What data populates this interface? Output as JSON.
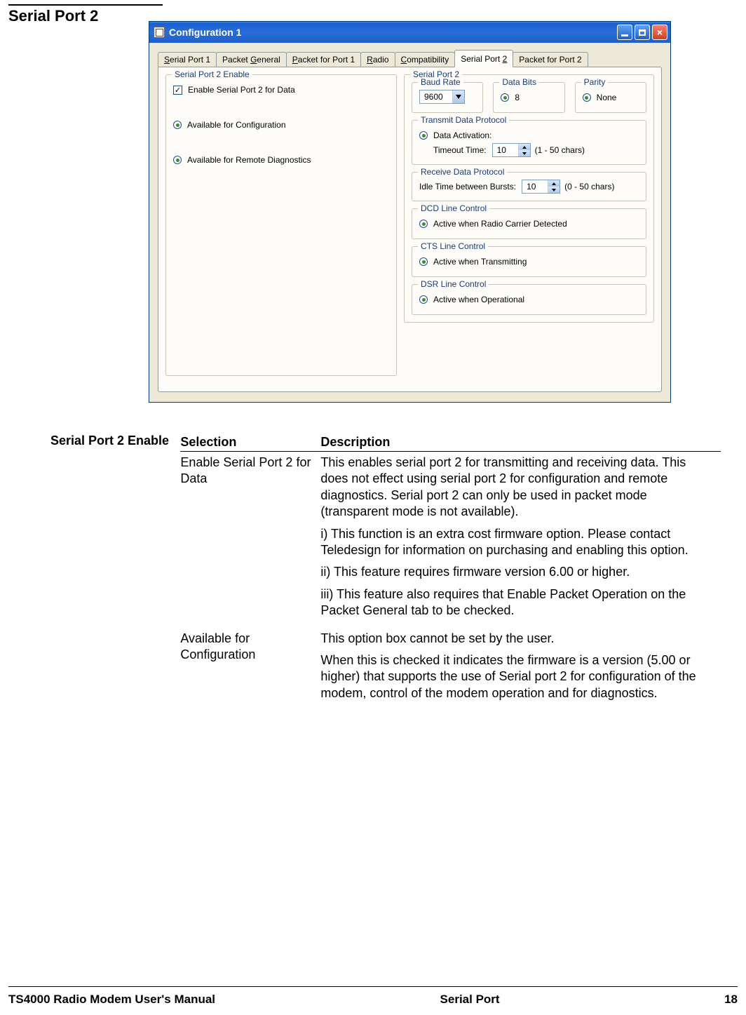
{
  "page": {
    "section_heading": "Serial Port 2",
    "footer_left": "TS4000 Radio Modem User's Manual",
    "footer_center": "Serial Port",
    "footer_right": "18"
  },
  "window": {
    "title": "Configuration 1",
    "tabs": [
      {
        "label_pre": "",
        "mnemonic": "S",
        "label_post": "erial Port 1"
      },
      {
        "label_pre": "Packet ",
        "mnemonic": "G",
        "label_post": "eneral"
      },
      {
        "label_pre": "",
        "mnemonic": "P",
        "label_post": "acket for Port 1"
      },
      {
        "label_pre": "",
        "mnemonic": "R",
        "label_post": "adio"
      },
      {
        "label_pre": "",
        "mnemonic": "C",
        "label_post": "ompatibility"
      },
      {
        "label_pre": "Serial Port ",
        "mnemonic": "2",
        "label_post": ""
      },
      {
        "label_pre": "Packet for Port 2",
        "mnemonic": "",
        "label_post": ""
      }
    ],
    "selected_tab_index": 5,
    "left": {
      "group_title": "Serial Port 2 Enable",
      "enable_label": "Enable Serial Port 2 for Data",
      "enable_checked": true,
      "avail_config_label": "Available for Configuration",
      "avail_diag_label": "Available for Remote Diagnostics"
    },
    "right": {
      "group_title": "Serial Port 2",
      "baud": {
        "title": "Baud Rate",
        "value": "9600"
      },
      "databits": {
        "title": "Data Bits",
        "label": "8"
      },
      "parity": {
        "title": "Parity",
        "label": "None"
      },
      "tx": {
        "title": "Transmit Data Protocol",
        "radio_label": "Data Activation:",
        "timeout_label": "Timeout Time:",
        "timeout_value": "10",
        "hint": "(1 - 50 chars)"
      },
      "rx": {
        "title": "Receive Data Protocol",
        "idle_label": "Idle Time between Bursts:",
        "idle_value": "10",
        "hint": "(0 - 50 chars)"
      },
      "dcd": {
        "title": "DCD Line Control",
        "label": "Active when Radio Carrier Detected"
      },
      "cts": {
        "title": "CTS Line Control",
        "label": "Active when Transmitting"
      },
      "dsr": {
        "title": "DSR Line Control",
        "label": "Active when Operational"
      }
    }
  },
  "narrative": {
    "row_label": "Serial Port 2 Enable",
    "headers": {
      "selection": "Selection",
      "description": "Description"
    },
    "rows": [
      {
        "selection": "Enable Serial Port 2 for Data",
        "paras": [
          "This enables serial port 2 for transmitting and receiving data.  This does not effect using serial port 2 for configuration and remote diagnostics.  Serial port 2 can only be used in packet mode (transparent mode is not available).",
          "i) This function is an extra cost firmware option.  Please contact Teledesign for information on purchasing and enabling this option.",
          "ii) This feature requires firmware version 6.00 or higher.",
          "iii) This feature also requires that Enable Packet Operation on the Packet General tab to be checked."
        ]
      },
      {
        "selection": "Available for Configuration",
        "paras": [
          "This option box cannot be set by the user.",
          "When this is checked it indicates the firmware is a version (5.00 or higher) that supports the use of Serial port 2 for configuration of the modem, control of the modem operation and for diagnostics."
        ]
      }
    ]
  }
}
